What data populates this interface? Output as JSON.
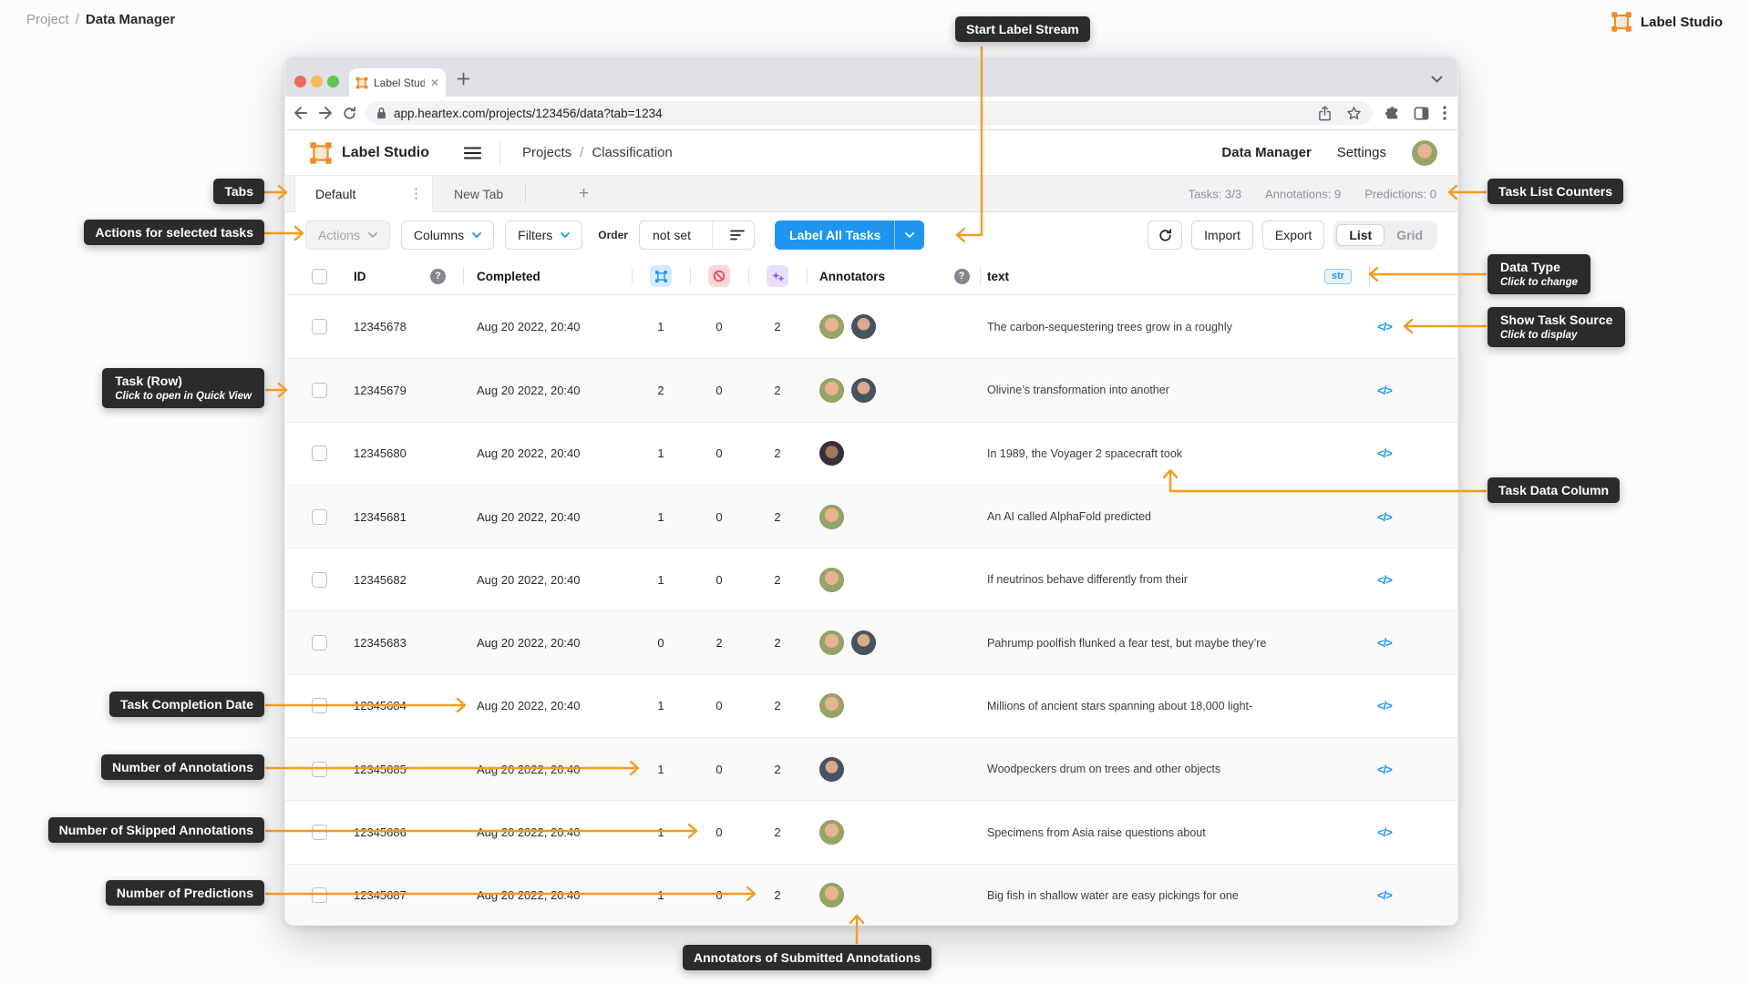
{
  "page": {
    "breadcrumb_project": "Project",
    "breadcrumb_sep": "/",
    "breadcrumb_current": "Data Manager",
    "brand_name": "Label Studio"
  },
  "callouts": {
    "tabs": "Tabs",
    "actions": "Actions for selected tasks",
    "start_label_stream": "Start Label Stream",
    "task_row_title": "Task (Row)",
    "task_row_sub": "Click to open in Quick View",
    "task_completion_date": "Task Completion Date",
    "number_of_annotations": "Number of Annotations",
    "number_of_skipped": "Number of Skipped Annotations",
    "number_of_predictions": "Number of Predictions",
    "task_list_counters": "Task List Counters",
    "data_type_title": "Data Type",
    "data_type_sub": "Click to change",
    "show_task_source_title": "Show Task Source",
    "show_task_source_sub": "Click to display",
    "task_data_column": "Task Data Column",
    "annotators_submitted": "Annotators of Submitted Annotations"
  },
  "browser": {
    "tab_title": "Label Studio",
    "url": "app.heartex.com/projects/123456/data?tab=1234"
  },
  "header": {
    "app_name": "Label Studio",
    "nav_projects": "Projects",
    "nav_sep": "/",
    "nav_page": "Classification",
    "link_data_manager": "Data Manager",
    "link_settings": "Settings"
  },
  "tabs": {
    "active_tab": "Default",
    "new_tab": "New Tab",
    "counters": {
      "tasks": "Tasks: 3/3",
      "annotations": "Annotations: 9",
      "predictions": "Predictions: 0"
    }
  },
  "toolbar": {
    "actions": "Actions",
    "columns": "Columns",
    "filters": "Filters",
    "order_label": "Order",
    "order_value": "not set",
    "label_all_tasks": "Label All Tasks",
    "import": "Import",
    "export": "Export",
    "view_list": "List",
    "view_grid": "Grid"
  },
  "icons": {
    "help_glyph": "?",
    "source_glyph": "</>",
    "annotations_column_icon": "bounding-box-icon",
    "cancelled_column_icon": "cancelled-icon",
    "predictions_column_icon": "sparkles-icon"
  },
  "table": {
    "columns": {
      "id": "ID",
      "completed": "Completed",
      "annotators": "Annotators",
      "text": "text"
    },
    "data_type_badge": "str",
    "rows": [
      {
        "id": "12345678",
        "completed": "Aug 20 2022, 20:40",
        "annotations": "1",
        "cancelled": "0",
        "predictions": "2",
        "annotators": [
          "woman",
          "man-jacket"
        ],
        "text": "The carbon-sequestering trees grow in a roughly"
      },
      {
        "id": "12345679",
        "completed": "Aug 20 2022, 20:40",
        "annotations": "2",
        "cancelled": "0",
        "predictions": "2",
        "annotators": [
          "woman",
          "man-jacket"
        ],
        "text": "Olivine’s transformation into another"
      },
      {
        "id": "12345680",
        "completed": "Aug 20 2022, 20:40",
        "annotations": "1",
        "cancelled": "0",
        "predictions": "2",
        "annotators": [
          "man-beard"
        ],
        "text": "In 1989, the Voyager 2 spacecraft took"
      },
      {
        "id": "12345681",
        "completed": "Aug 20 2022, 20:40",
        "annotations": "1",
        "cancelled": "0",
        "predictions": "2",
        "annotators": [
          "woman"
        ],
        "text": "An AI called AlphaFold predicted"
      },
      {
        "id": "12345682",
        "completed": "Aug 20 2022, 20:40",
        "annotations": "1",
        "cancelled": "0",
        "predictions": "2",
        "annotators": [
          "woman"
        ],
        "text": "If neutrinos behave differently from their"
      },
      {
        "id": "12345683",
        "completed": "Aug 20 2022, 20:40",
        "annotations": "0",
        "cancelled": "2",
        "predictions": "2",
        "annotators": [
          "woman",
          "man-jacket"
        ],
        "text": "Pahrump poolfish flunked a fear test, but maybe they’re"
      },
      {
        "id": "12345684",
        "completed": "Aug 20 2022, 20:40",
        "annotations": "1",
        "cancelled": "0",
        "predictions": "2",
        "annotators": [
          "woman"
        ],
        "text": "Millions of ancient stars spanning about 18,000 light-"
      },
      {
        "id": "12345685",
        "completed": "Aug 20 2022, 20:40",
        "annotations": "1",
        "cancelled": "0",
        "predictions": "2",
        "annotators": [
          "man-jacket"
        ],
        "text": "Woodpeckers drum on trees and other objects"
      },
      {
        "id": "12345686",
        "completed": "Aug 20 2022, 20:40",
        "annotations": "1",
        "cancelled": "0",
        "predictions": "2",
        "annotators": [
          "woman"
        ],
        "text": "Specimens from Asia raise questions about"
      },
      {
        "id": "12345687",
        "completed": "Aug 20 2022, 20:40",
        "annotations": "1",
        "cancelled": "0",
        "predictions": "2",
        "annotators": [
          "woman"
        ],
        "text": "Big fish in shallow water are easy pickings for one"
      }
    ]
  },
  "colors": {
    "accent_orange": "#F59B22",
    "primary_blue": "#1E96F0",
    "callout_bg": "#2B2B2B",
    "logo_orange": "#F28B25"
  }
}
